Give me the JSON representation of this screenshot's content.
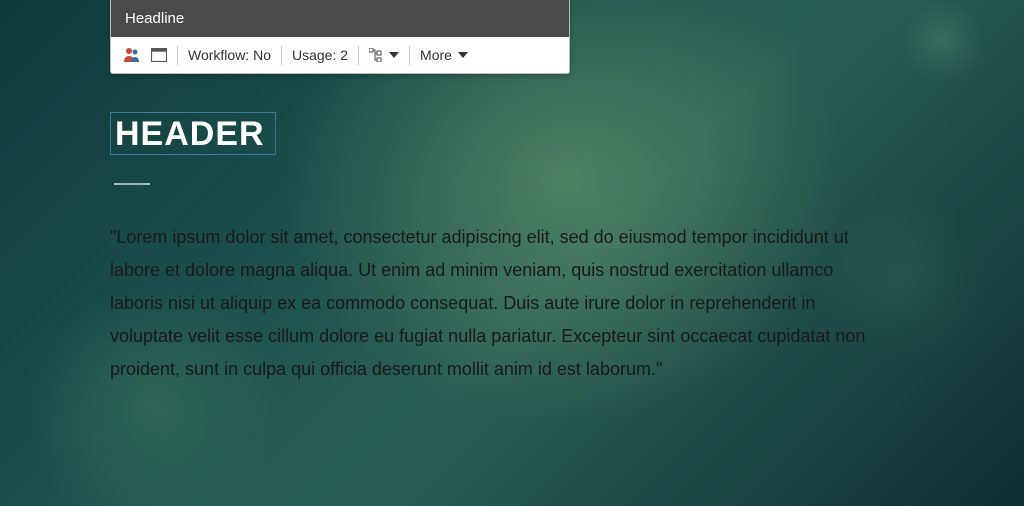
{
  "panel": {
    "title": "Headline",
    "workflow": "Workflow: No",
    "usage": "Usage: 2",
    "more": "More"
  },
  "header": "HEADER",
  "body": "\"Lorem ipsum dolor sit amet, consectetur adipiscing elit, sed do eiusmod tempor incididunt ut labore et dolore magna aliqua. Ut enim ad minim veniam, quis nostrud exercitation ullamco laboris nisi ut aliquip ex ea commodo consequat. Duis aute irure dolor in reprehenderit in voluptate velit esse cillum dolore eu fugiat nulla pariatur. Excepteur sint occaecat cupidatat non proident, sunt in culpa qui officia deserunt mollit anim id est laborum.\""
}
